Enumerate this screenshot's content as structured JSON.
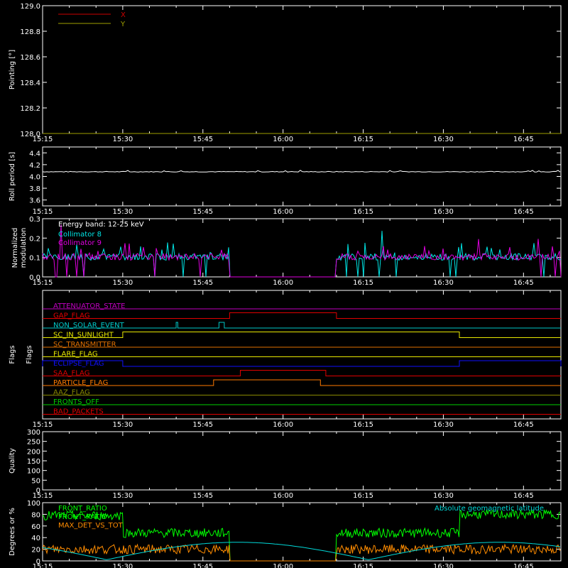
{
  "chart_data": [
    {
      "type": "line",
      "ylabel": "Pointing [°]",
      "ylim": [
        128.0,
        129.0
      ],
      "yticks": [
        "128.0",
        "128.2",
        "128.4",
        "128.6",
        "128.8",
        "129.0"
      ],
      "xticks": [
        "15:15",
        "15:30",
        "15:45",
        "16:00",
        "16:15",
        "16:30",
        "16:45"
      ],
      "series": [
        {
          "name": "X",
          "color": "#cc0000",
          "values": [
            128.0,
            128.0
          ]
        },
        {
          "name": "Y",
          "color": "#a0a000",
          "values": [
            128.0,
            128.0
          ]
        }
      ]
    },
    {
      "type": "line",
      "ylabel": "Roll period [s]",
      "ylim": [
        3.5,
        4.5
      ],
      "yticks": [
        "3.6",
        "3.8",
        "4.0",
        "4.2",
        "4.4"
      ],
      "xticks": [
        "15:15",
        "15:30",
        "15:45",
        "16:00",
        "16:15",
        "16:30",
        "16:45"
      ],
      "series": [
        {
          "name": "",
          "color": "#ffffff",
          "values": [
            4.08,
            4.08
          ]
        }
      ]
    },
    {
      "type": "line",
      "ylabel": "Normalized modulation",
      "ylabel_lines": [
        "Normalized",
        "modulation"
      ],
      "ylim": [
        0.0,
        0.3
      ],
      "yticks": [
        "0.0",
        "0.1",
        "0.2",
        "0.3"
      ],
      "xticks": [
        "15:15",
        "15:30",
        "15:45",
        "16:00",
        "16:15",
        "16:30",
        "16:45"
      ],
      "annotation": "Energy band: 12-25 keV",
      "gap": [
        "15:50",
        "16:10"
      ],
      "series": [
        {
          "name": "Collimator 8",
          "color": "#00e5e5",
          "level": 0.1
        },
        {
          "name": "Collimator 9",
          "color": "#e000e0",
          "level": 0.1
        }
      ]
    },
    {
      "type": "line",
      "ylabel": "Flags",
      "xticks": [
        "15:15",
        "15:30",
        "15:45",
        "16:00",
        "16:15",
        "16:30",
        "16:45"
      ],
      "flags": [
        {
          "name": "ATTENUATOR_STATE",
          "color": "#c000c0",
          "on": []
        },
        {
          "name": "GAP_FLAG",
          "color": "#e00000",
          "on": [
            [
              "15:50",
              "16:10"
            ]
          ]
        },
        {
          "name": "NON_SOLAR_EVENT",
          "color": "#00c8c8",
          "on": [
            [
              "15:40",
              "15:40.3"
            ],
            [
              "15:48",
              "15:49"
            ]
          ]
        },
        {
          "name": "SC_IN_SUNLIGHT",
          "color": "#e8e800",
          "on": [
            [
              "15:30",
              "16:33"
            ]
          ]
        },
        {
          "name": "SC_TRANSMITTER",
          "color": "#e07000",
          "on": []
        },
        {
          "name": "FLARE_FLAG",
          "color": "#e8e800",
          "on": []
        },
        {
          "name": "ECLIPSE_FLAG",
          "color": "#1010ff",
          "on": [
            [
              "15:15",
              "15:30"
            ],
            [
              "16:33",
              "16:52"
            ]
          ]
        },
        {
          "name": "SAA_FLAG",
          "color": "#e00000",
          "on": [
            [
              "15:52",
              "16:08"
            ]
          ]
        },
        {
          "name": "PARTICLE_FLAG",
          "color": "#ff7a00",
          "on": [
            [
              "15:47",
              "16:07"
            ]
          ]
        },
        {
          "name": "AAZ_FLAG",
          "color": "#8a8a00",
          "on": []
        },
        {
          "name": "FRONTS_OFF",
          "color": "#00d000",
          "on": []
        },
        {
          "name": "BAD_PACKETS",
          "color": "#e00000",
          "on": []
        }
      ]
    },
    {
      "type": "line",
      "ylabel": "Quality",
      "ylim": [
        0,
        300
      ],
      "yticks": [
        "0",
        "50",
        "100",
        "150",
        "200",
        "250",
        "300"
      ],
      "xticks": [
        "15:15",
        "15:30",
        "15:45",
        "16:00",
        "16:15",
        "16:30",
        "16:45"
      ],
      "series": [
        {
          "name": "",
          "color": "#ffffff",
          "values": []
        }
      ]
    },
    {
      "type": "line",
      "ylabel": "Degrees or %",
      "ylim": [
        0,
        100
      ],
      "yticks": [
        "0",
        "20",
        "40",
        "60",
        "80",
        "100"
      ],
      "xticks": [
        "15:15",
        "15:30",
        "15:45",
        "16:00",
        "16:15",
        "16:30",
        "16:45"
      ],
      "gap": [
        "15:50",
        "16:10"
      ],
      "series": [
        {
          "name": "FRONT_RATIO",
          "color": "#00ff00"
        },
        {
          "name": "FRONT_RATIO",
          "color": "#00ff00"
        },
        {
          "name": "MAX_DET_VS_TOT",
          "color": "#ff8c00"
        },
        {
          "name": "Absolute geomagnetic latitude",
          "color": "#00d8d8"
        }
      ]
    }
  ]
}
